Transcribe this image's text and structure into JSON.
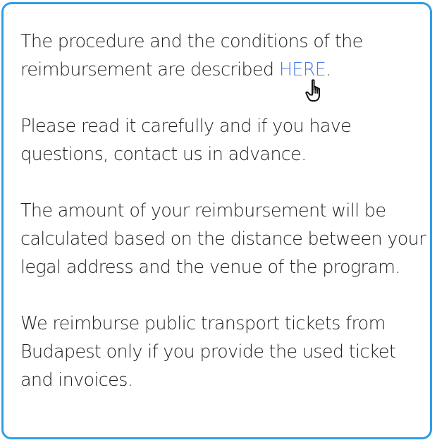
{
  "paragraphs": {
    "p1_before": "The procedure and the conditions of the reimbursement are described ",
    "p1_link": "HERE",
    "p1_after": ".",
    "p2": "Please read it carefully and if you have questions, contact us in advance.",
    "p3": "The amount of your reimbursement will be calculated based on the distance between your legal address and the venue of the program.",
    "p4": "We reimburse public transport tickets from Budapest only if you provide the used ticket and invoices."
  },
  "icons": {
    "cursor": "hand-pointer-icon"
  },
  "colors": {
    "border": "#2f9de8",
    "link": "#4a78e8",
    "text": "#1f1f1f"
  }
}
